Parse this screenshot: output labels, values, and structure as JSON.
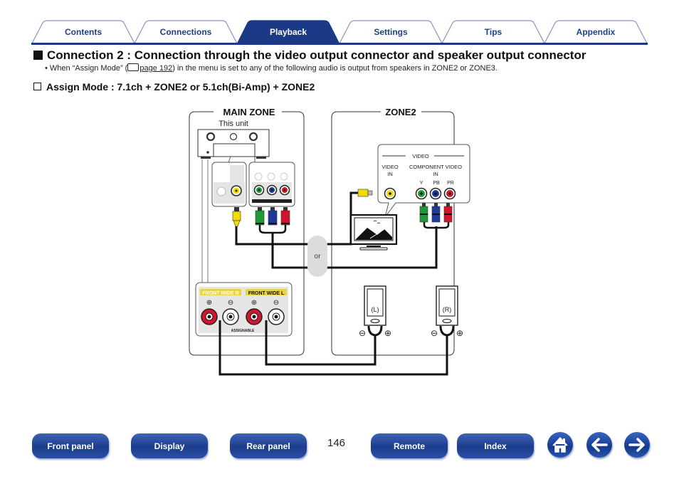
{
  "nav": {
    "tabs": [
      {
        "label": "Contents",
        "active": false
      },
      {
        "label": "Connections",
        "active": false
      },
      {
        "label": "Playback",
        "active": true
      },
      {
        "label": "Settings",
        "active": false
      },
      {
        "label": "Tips",
        "active": false
      },
      {
        "label": "Appendix",
        "active": false
      }
    ]
  },
  "content": {
    "heading": "Connection 2 : Connection through the video output connector and speaker output connector",
    "note_prefix": "• When “Assign Mode” (",
    "note_link": "page 192",
    "note_suffix": ") in the menu is set to any of the following audio is output from speakers in ZONE2 or ZONE3.",
    "subheading": "Assign Mode : 7.1ch + ZONE2 or 5.1ch(Bi-Amp) + ZONE2"
  },
  "diagram": {
    "main_zone_label": "MAIN ZONE",
    "this_unit_label": "This unit",
    "zone2_label": "ZONE2",
    "video_group_label": "VIDEO",
    "video_in_label_1": "VIDEO",
    "video_in_label_2": "IN",
    "component_label_1": "COMPONENT VIDEO",
    "component_label_2": "IN",
    "y_label": "Y",
    "pb_label": "PB",
    "pr_label": "PR",
    "or_label": "or",
    "front_wide_r": "FRONT WIDE R",
    "front_wide_l": "FRONT WIDE L",
    "assignable_label": "ASSIGNABLE",
    "speaker_left": "(L)",
    "speaker_right": "(R)",
    "plus": "⊕",
    "minus": "⊖",
    "colors": {
      "yellow": "#f2dc00",
      "green": "#1f9a3a",
      "blue": "#1d3a9a",
      "red": "#d1152b"
    }
  },
  "footer": {
    "buttons": [
      "Front panel",
      "Display",
      "Rear panel",
      "Remote",
      "Index"
    ],
    "page_number": "146",
    "icons": [
      "home-icon",
      "back-arrow-icon",
      "forward-arrow-icon"
    ]
  }
}
